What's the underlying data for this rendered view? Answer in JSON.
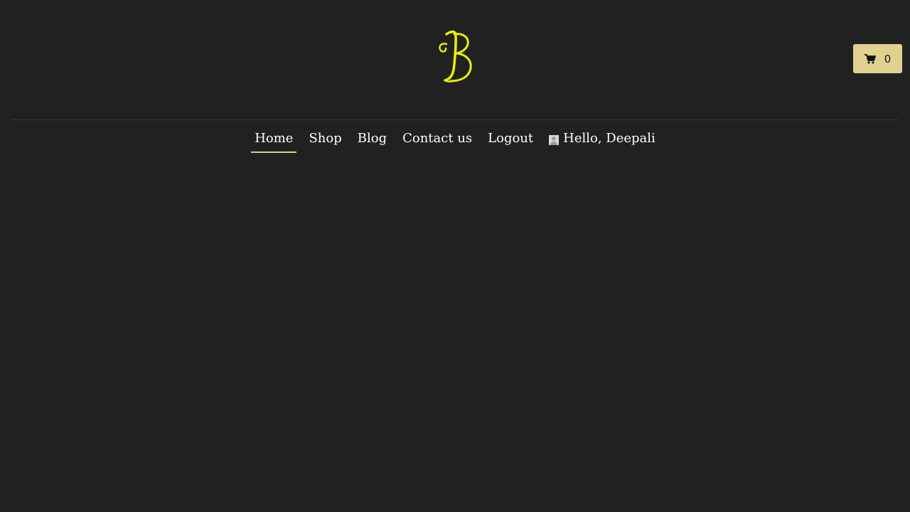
{
  "brand": {
    "logo_icon": "script-b-logo",
    "accent_color": "#e8f000"
  },
  "cart": {
    "icon": "shopping-cart-icon",
    "count": "0",
    "button_color": "#e0d190"
  },
  "nav": {
    "items": [
      {
        "label": "Home",
        "active": true
      },
      {
        "label": "Shop"
      },
      {
        "label": "Blog"
      },
      {
        "label": "Contact us"
      },
      {
        "label": "Logout"
      }
    ],
    "user": {
      "icon": "user-avatar-icon",
      "greeting": "Hello, Deepali"
    },
    "active_underline_color": "#e0d190"
  }
}
